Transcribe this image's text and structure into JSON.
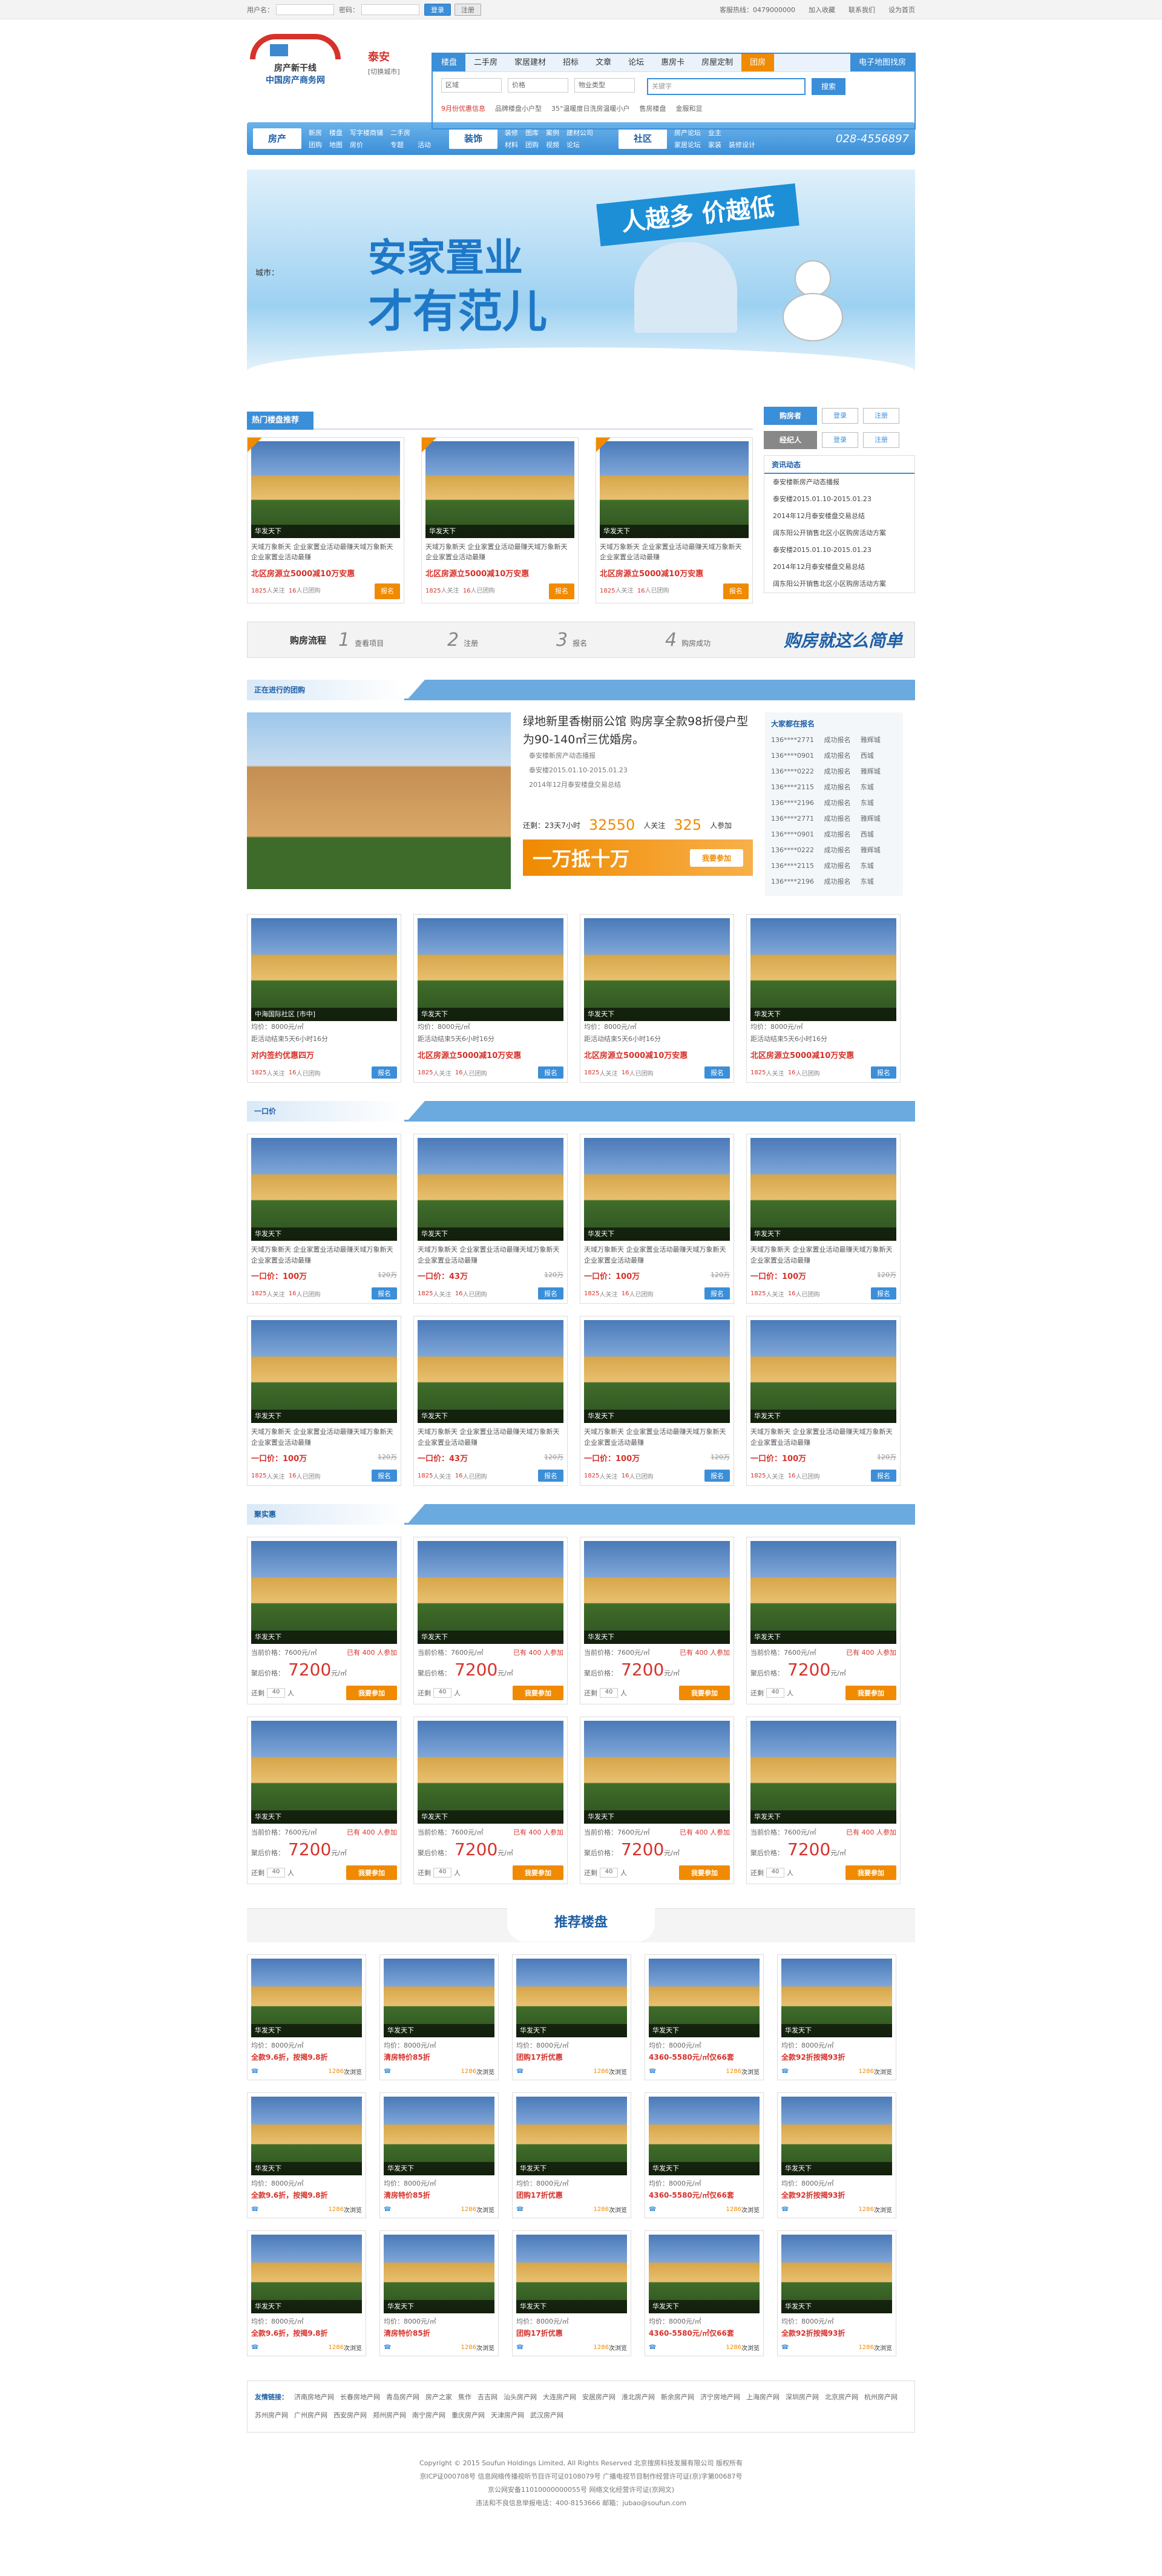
{
  "topbar": {
    "user_label": "用户名：",
    "pwd_label": "密码：",
    "login": "登录",
    "reg": "注册",
    "links": [
      "客服热线：0479000000",
      "加入收藏",
      "联系我们",
      "设为首页"
    ]
  },
  "city": {
    "name": "泰安",
    "switch": "[切换城市]"
  },
  "logo": {
    "t1": "房产新干线",
    "t2": "中国房产商务网"
  },
  "search": {
    "tabs": [
      "楼盘",
      "二手房",
      "家居建材",
      "招标",
      "文章",
      "论坛",
      "惠房卡",
      "房屋定制",
      "团房"
    ],
    "event": "电子地图找房",
    "selects": [
      "区域",
      "价格",
      "物业类型"
    ],
    "kw_placeholder": "关键字",
    "btn": "搜索",
    "hot": [
      "9月份优惠信息",
      "品牌楼盘小户型",
      "35°温暖度日洗房温暖小户",
      "售房楼盘",
      "金服和显"
    ]
  },
  "nav": [
    {
      "h": "房产",
      "items": [
        "新房",
        "楼盘",
        "写字楼商铺",
        "二手房",
        "",
        "团购",
        "地图",
        "房价",
        "专题",
        "活动"
      ]
    },
    {
      "h": "装饰",
      "items": [
        "装修",
        "图库",
        "案例",
        "建材公司",
        "",
        "材料",
        "团购",
        "视频",
        "论坛",
        "",
        ""
      ]
    },
    {
      "h": "社区",
      "items": [
        "房产论坛",
        "业主",
        "",
        "家居论坛",
        "家装",
        "装修设计"
      ]
    }
  ],
  "nav_tel": "028-4556897",
  "banner": {
    "l1": "安家置业",
    "l2": "才有范儿",
    "slogan": "人越多 价越低",
    "city_label": "城市："
  },
  "hot": {
    "title": "热门楼盘推荐",
    "cards": [
      {
        "tag": "华发天下",
        "desc": "天域万象新天 企业家置业活动最赚天域万象新天 企业家置业活动最赚",
        "price": "北区房源立5000减10万安惠",
        "stat1": "1825",
        "stat1l": "人关注",
        "stat2": "16",
        "stat2l": "人已团购",
        "btn": "报名"
      },
      {
        "tag": "华发天下",
        "desc": "天域万象新天 企业家置业活动最赚天域万象新天 企业家置业活动最赚",
        "price": "北区房源立5000减10万安惠",
        "stat1": "1825",
        "stat1l": "人关注",
        "stat2": "16",
        "stat2l": "人已团购",
        "btn": "报名"
      },
      {
        "tag": "华发天下",
        "desc": "天域万象新天 企业家置业活动最赚天域万象新天 企业家置业活动最赚",
        "price": "北区房源立5000减10万安惠",
        "stat1": "1825",
        "stat1l": "人关注",
        "stat2": "16",
        "stat2l": "人已团购",
        "btn": "报名"
      }
    ]
  },
  "side": {
    "roles": [
      {
        "l": "购房者",
        "a": "登录",
        "b": "注册"
      },
      {
        "l": "经纪人",
        "a": "登录",
        "b": "注册"
      }
    ],
    "news_title": "资讯动态",
    "news": [
      "泰安楼新房产动态播报",
      "泰安楼2015.01.10-2015.01.23",
      "2014年12月泰安楼盘交易总结",
      "阔东阳公开销售北区小区购房活动方案",
      "泰安楼2015.01.10-2015.01.23",
      "2014年12月泰安楼盘交易总结",
      "阔东阳公开销售北区小区购房活动方案"
    ]
  },
  "process": {
    "title": "购房流程",
    "steps": [
      {
        "n": "1",
        "t": "查看项目"
      },
      {
        "n": "2",
        "t": "注册"
      },
      {
        "n": "3",
        "t": "报名"
      },
      {
        "n": "4",
        "t": "购房成功"
      }
    ],
    "slogan": "购房就这么简单"
  },
  "ongoing": {
    "bar": "正在进行的团购",
    "title": "绿地新里香榭丽公馆 购房享全款98折侵户型为90-140㎡三优婚房。",
    "items": [
      "泰安楼新房产动态播报",
      "泰安楼2015.01.10-2015.01.23",
      "2014年12月泰安楼盘交易总结"
    ],
    "time_label": "还剩：23天7小时",
    "n1": "32550",
    "n1l": "人关注",
    "n2": "325",
    "n2l": "人参加",
    "offer": "一万抵十万",
    "join": "我要参加",
    "grp_title": "大家都在报名",
    "grp": [
      [
        "136****2771",
        "成功报名",
        "雅辉城"
      ],
      [
        "136****0901",
        "成功报名",
        "西城"
      ],
      [
        "136****0222",
        "成功报名",
        "雅辉城"
      ],
      [
        "136****2115",
        "成功报名",
        "东城"
      ],
      [
        "136****2196",
        "成功报名",
        "东城"
      ],
      [
        "136****2771",
        "成功报名",
        "雅辉城"
      ],
      [
        "136****0901",
        "成功报名",
        "西城"
      ],
      [
        "136****0222",
        "成功报名",
        "雅辉城"
      ],
      [
        "136****2115",
        "成功报名",
        "东城"
      ],
      [
        "136****2196",
        "成功报名",
        "东城"
      ]
    ]
  },
  "ongoing_cards": [
    {
      "tag": "中海国际社区 [市中]",
      "l1": "均价：8000元/㎡",
      "l2": "距活动结束5天6小时16分",
      "p": "对内签约优惠四万",
      "a": "1825",
      "al": "人关注",
      "b": "16",
      "bl": "人已团购",
      "btn": "报名"
    },
    {
      "tag": "华发天下",
      "l1": "均价：8000元/㎡",
      "l2": "距活动结束5天6小时16分",
      "p": "北区房源立5000减10万安惠",
      "a": "1825",
      "al": "人关注",
      "b": "16",
      "bl": "人已团购",
      "btn": "报名"
    },
    {
      "tag": "华发天下",
      "l1": "均价：8000元/㎡",
      "l2": "距活动结束5天6小时16分",
      "p": "北区房源立5000减10万安惠",
      "a": "1825",
      "al": "人关注",
      "b": "16",
      "bl": "人已团购",
      "btn": "报名"
    },
    {
      "tag": "华发天下",
      "l1": "均价：8000元/㎡",
      "l2": "距活动结束5天6小时16分",
      "p": "北区房源立5000减10万安惠",
      "a": "1825",
      "al": "人关注",
      "b": "16",
      "bl": "人已团购",
      "btn": "报名"
    }
  ],
  "yikoujia": {
    "bar": "一口价",
    "cards": [
      {
        "tag": "华发天下",
        "d": "天域万象新天 企业家置业活动最赚天域万象新天 企业家置业活动最赚",
        "p": "一口价：100万",
        "s": "120万",
        "a": "1825",
        "al": "人关注",
        "b": "16",
        "bl": "人已团购",
        "btn": "报名"
      },
      {
        "tag": "华发天下",
        "d": "天域万象新天 企业家置业活动最赚天域万象新天 企业家置业活动最赚",
        "p": "一口价：43万",
        "s": "120万",
        "a": "1825",
        "al": "人关注",
        "b": "16",
        "bl": "人已团购",
        "btn": "报名"
      },
      {
        "tag": "华发天下",
        "d": "天域万象新天 企业家置业活动最赚天域万象新天 企业家置业活动最赚",
        "p": "一口价：100万",
        "s": "120万",
        "a": "1825",
        "al": "人关注",
        "b": "16",
        "bl": "人已团购",
        "btn": "报名"
      },
      {
        "tag": "华发天下",
        "d": "天域万象新天 企业家置业活动最赚天域万象新天 企业家置业活动最赚",
        "p": "一口价：100万",
        "s": "120万",
        "a": "1825",
        "al": "人关注",
        "b": "16",
        "bl": "人已团购",
        "btn": "报名"
      },
      {
        "tag": "华发天下",
        "d": "天域万象新天 企业家置业活动最赚天域万象新天 企业家置业活动最赚",
        "p": "一口价：100万",
        "s": "120万",
        "a": "1825",
        "al": "人关注",
        "b": "16",
        "bl": "人已团购",
        "btn": "报名"
      },
      {
        "tag": "华发天下",
        "d": "天域万象新天 企业家置业活动最赚天域万象新天 企业家置业活动最赚",
        "p": "一口价：43万",
        "s": "120万",
        "a": "1825",
        "al": "人关注",
        "b": "16",
        "bl": "人已团购",
        "btn": "报名"
      },
      {
        "tag": "华发天下",
        "d": "天域万象新天 企业家置业活动最赚天域万象新天 企业家置业活动最赚",
        "p": "一口价：100万",
        "s": "120万",
        "a": "1825",
        "al": "人关注",
        "b": "16",
        "bl": "人已团购",
        "btn": "报名"
      },
      {
        "tag": "华发天下",
        "d": "天域万象新天 企业家置业活动最赚天域万象新天 企业家置业活动最赚",
        "p": "一口价：100万",
        "s": "120万",
        "a": "1825",
        "al": "人关注",
        "b": "16",
        "bl": "人已团购",
        "btn": "报名"
      }
    ]
  },
  "jutuan": {
    "bar": "聚实惠",
    "cards": [
      {
        "tag": "华发天下",
        "p1": "当前价格：7600元/㎡",
        "p1r": "已有 400 人参加",
        "p2": "聚后价格：",
        "p2v": "7200",
        "p2u": "元/㎡",
        "q": "还剩",
        "qn": "40",
        "qu": "人",
        "btn": "我要参加"
      },
      {
        "tag": "华发天下",
        "p1": "当前价格：7600元/㎡",
        "p1r": "已有 400 人参加",
        "p2": "聚后价格：",
        "p2v": "7200",
        "p2u": "元/㎡",
        "q": "还剩",
        "qn": "40",
        "qu": "人",
        "btn": "我要参加"
      },
      {
        "tag": "华发天下",
        "p1": "当前价格：7600元/㎡",
        "p1r": "已有 400 人参加",
        "p2": "聚后价格：",
        "p2v": "7200",
        "p2u": "元/㎡",
        "q": "还剩",
        "qn": "40",
        "qu": "人",
        "btn": "我要参加"
      },
      {
        "tag": "华发天下",
        "p1": "当前价格：7600元/㎡",
        "p1r": "已有 400 人参加",
        "p2": "聚后价格：",
        "p2v": "7200",
        "p2u": "元/㎡",
        "q": "还剩",
        "qn": "40",
        "qu": "人",
        "btn": "我要参加"
      },
      {
        "tag": "华发天下",
        "p1": "当前价格：7600元/㎡",
        "p1r": "已有 400 人参加",
        "p2": "聚后价格：",
        "p2v": "7200",
        "p2u": "元/㎡",
        "q": "还剩",
        "qn": "40",
        "qu": "人",
        "btn": "我要参加"
      },
      {
        "tag": "华发天下",
        "p1": "当前价格：7600元/㎡",
        "p1r": "已有 400 人参加",
        "p2": "聚后价格：",
        "p2v": "7200",
        "p2u": "元/㎡",
        "q": "还剩",
        "qn": "40",
        "qu": "人",
        "btn": "我要参加"
      },
      {
        "tag": "华发天下",
        "p1": "当前价格：7600元/㎡",
        "p1r": "已有 400 人参加",
        "p2": "聚后价格：",
        "p2v": "7200",
        "p2u": "元/㎡",
        "q": "还剩",
        "qn": "40",
        "qu": "人",
        "btn": "我要参加"
      },
      {
        "tag": "华发天下",
        "p1": "当前价格：7600元/㎡",
        "p1r": "已有 400 人参加",
        "p2": "聚后价格：",
        "p2v": "7200",
        "p2u": "元/㎡",
        "q": "还剩",
        "qn": "40",
        "qu": "人",
        "btn": "我要参加"
      }
    ]
  },
  "recommend": {
    "title": "推荐楼盘",
    "cards": [
      {
        "tag": "华发天下",
        "l": "均价：8000元/㎡",
        "h": "全款9.6折，按揭9.8折",
        "v": "1286",
        "vl": "次浏览"
      },
      {
        "tag": "华发天下",
        "l": "均价：8000元/㎡",
        "h": "清房特价85折",
        "v": "1286",
        "vl": "次浏览"
      },
      {
        "tag": "华发天下",
        "l": "均价：8000元/㎡",
        "h": "团购17折优惠",
        "v": "1286",
        "vl": "次浏览"
      },
      {
        "tag": "华发天下",
        "l": "均价：8000元/㎡",
        "h": "4360-5580元/㎡仅66套",
        "v": "1286",
        "vl": "次浏览"
      },
      {
        "tag": "华发天下",
        "l": "均价：8000元/㎡",
        "h": "全款92折按揭93折",
        "v": "1286",
        "vl": "次浏览"
      },
      {
        "tag": "华发天下",
        "l": "均价：8000元/㎡",
        "h": "全款9.6折，按揭9.8折",
        "v": "1286",
        "vl": "次浏览"
      },
      {
        "tag": "华发天下",
        "l": "均价：8000元/㎡",
        "h": "清房特价85折",
        "v": "1286",
        "vl": "次浏览"
      },
      {
        "tag": "华发天下",
        "l": "均价：8000元/㎡",
        "h": "团购17折优惠",
        "v": "1286",
        "vl": "次浏览"
      },
      {
        "tag": "华发天下",
        "l": "均价：8000元/㎡",
        "h": "4360-5580元/㎡仅66套",
        "v": "1286",
        "vl": "次浏览"
      },
      {
        "tag": "华发天下",
        "l": "均价：8000元/㎡",
        "h": "全款92折按揭93折",
        "v": "1286",
        "vl": "次浏览"
      },
      {
        "tag": "华发天下",
        "l": "均价：8000元/㎡",
        "h": "全款9.6折，按揭9.8折",
        "v": "1286",
        "vl": "次浏览"
      },
      {
        "tag": "华发天下",
        "l": "均价：8000元/㎡",
        "h": "清房特价85折",
        "v": "1286",
        "vl": "次浏览"
      },
      {
        "tag": "华发天下",
        "l": "均价：8000元/㎡",
        "h": "团购17折优惠",
        "v": "1286",
        "vl": "次浏览"
      },
      {
        "tag": "华发天下",
        "l": "均价：8000元/㎡",
        "h": "4360-5580元/㎡仅66套",
        "v": "1286",
        "vl": "次浏览"
      },
      {
        "tag": "华发天下",
        "l": "均价：8000元/㎡",
        "h": "全款92折按揭93折",
        "v": "1286",
        "vl": "次浏览"
      }
    ]
  },
  "friend": {
    "title": "友情链接：",
    "links": [
      "济南房地产网",
      "长春房地产网",
      "青岛房产网",
      "房产之家",
      "焦作",
      "吉吉网",
      "汕头房产网",
      "大连房产网",
      "安居房产网",
      "淮北房产网",
      "新余房产网",
      "济宁房地产网",
      "上海房产网",
      "深圳房产网",
      "北京房产网",
      "杭州房产网",
      "苏州房产网",
      "广州房产网",
      "西安房产网",
      "郑州房产网",
      "南宁房产网",
      "重庆房产网",
      "天津房产网",
      "武汉房产网"
    ]
  },
  "footer": [
    "Copyright © 2015 Soufun Holdings Limited, All Rights Reserved 北京搜房科技发展有限公司 版权所有",
    "京ICP证000708号 信息网络传播视听节目许可证0108079号 广播电视节目制作经营许可证(京)字第00687号",
    "京公网安备11010000000055号 网络文化经营许可证(京网文)",
    "违法和不良信息举报电话：400-8153666 邮箱：jubao@soufun.com"
  ]
}
